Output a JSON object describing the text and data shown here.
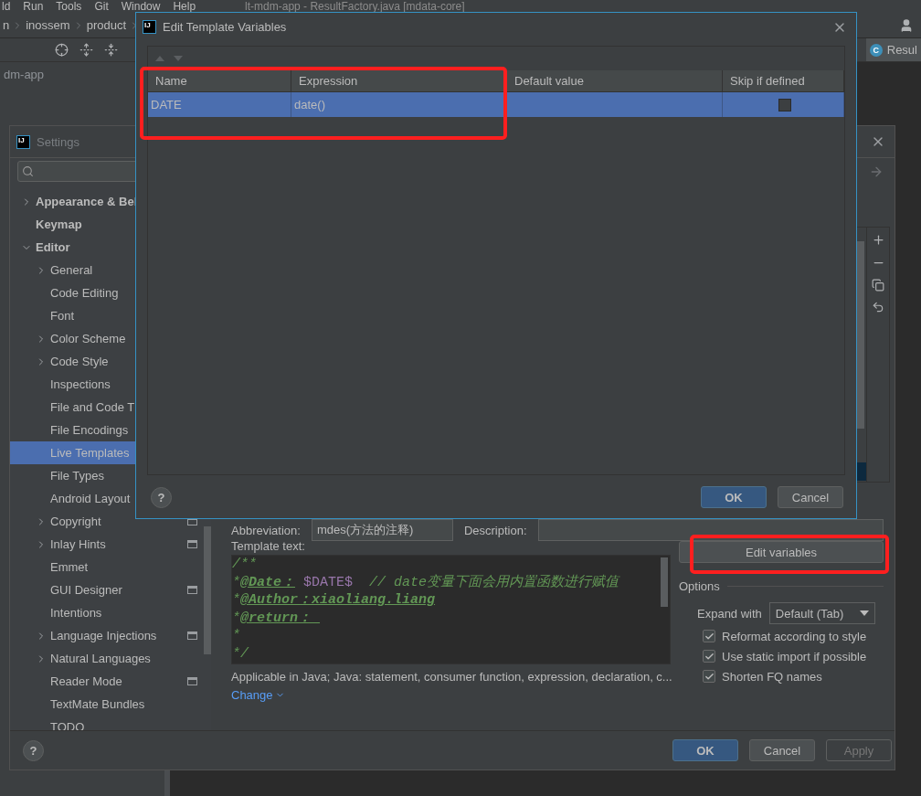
{
  "ide": {
    "menu": [
      "ld",
      "Run",
      "Tools",
      "Git",
      "Window",
      "Help"
    ],
    "title": "lt-mdm-app - ResultFactory.java [mdata-core]",
    "breadcrumbs": [
      "n",
      "inossem",
      "product"
    ],
    "project_root": "dm-app",
    "editor_tab_icon": "C",
    "editor_tab": "Resul"
  },
  "settings": {
    "logo": "IJ",
    "title": "Settings",
    "tree": [
      {
        "label": "Appearance & Bel",
        "expanded": false,
        "selected": false
      },
      {
        "label": "Keymap",
        "selected": false
      },
      {
        "label": "Editor",
        "expanded": true,
        "selected": false,
        "children": [
          {
            "label": "General",
            "expanded": false,
            "selected": false,
            "project_level": false
          },
          {
            "label": "Code Editing",
            "selected": false,
            "project_level": false
          },
          {
            "label": "Font",
            "selected": false,
            "project_level": false
          },
          {
            "label": "Color Scheme",
            "expanded": false,
            "selected": false,
            "project_level": false
          },
          {
            "label": "Code Style",
            "expanded": false,
            "selected": false,
            "project_level": false
          },
          {
            "label": "Inspections",
            "selected": false,
            "project_level": false
          },
          {
            "label": "File and Code T",
            "selected": false,
            "project_level": false
          },
          {
            "label": "File Encodings",
            "selected": false,
            "project_level": false
          },
          {
            "label": "Live Templates",
            "selected": true,
            "project_level": false
          },
          {
            "label": "File Types",
            "selected": false,
            "project_level": false
          },
          {
            "label": "Android Layout",
            "selected": false,
            "project_level": false
          },
          {
            "label": "Copyright",
            "expanded": false,
            "selected": false,
            "project_level": true
          },
          {
            "label": "Inlay Hints",
            "expanded": false,
            "selected": false,
            "project_level": true
          },
          {
            "label": "Emmet",
            "selected": false,
            "project_level": false
          },
          {
            "label": "GUI Designer",
            "selected": false,
            "project_level": true
          },
          {
            "label": "Intentions",
            "selected": false,
            "project_level": false
          },
          {
            "label": "Language Injections",
            "expanded": false,
            "selected": false,
            "project_level": true
          },
          {
            "label": "Natural Languages",
            "expanded": false,
            "selected": false,
            "project_level": false
          },
          {
            "label": "Reader Mode",
            "selected": false,
            "project_level": true
          },
          {
            "label": "TextMate Bundles",
            "selected": false,
            "project_level": false
          },
          {
            "label": "TODO",
            "selected": false,
            "project_level": false
          }
        ]
      }
    ],
    "abbreviation": {
      "label": "Abbreviation:",
      "value": "mdes(方法的注释)"
    },
    "description": {
      "label": "Description:"
    },
    "template_text": {
      "label": "Template text:",
      "lines": [
        [
          {
            "text": "/**",
            "kind": "comment"
          }
        ],
        [
          {
            "text": "*",
            "kind": "comment"
          },
          {
            "text": "@Date：",
            "kind": "tag"
          },
          {
            "text": " $DATE$",
            "kind": "variable"
          },
          {
            "text": "  // date变量下面会用内置函数进行赋值",
            "kind": "comment"
          }
        ],
        [
          {
            "text": "*",
            "kind": "comment"
          },
          {
            "text": "@Author：xiaoliang.liang",
            "kind": "tag"
          }
        ],
        [
          {
            "text": "*",
            "kind": "comment"
          },
          {
            "text": "@return： ",
            "kind": "tag"
          }
        ],
        [
          {
            "text": "*",
            "kind": "comment"
          }
        ],
        [
          {
            "text": "*/",
            "kind": "comment"
          }
        ]
      ]
    },
    "edit_variables": "Edit variables",
    "options": {
      "title": "Options",
      "expand_with": {
        "label": "Expand with",
        "value": "Default (Tab)"
      },
      "checkboxes": [
        {
          "label": "Reformat according to style",
          "checked": true
        },
        {
          "label": "Use static import if possible",
          "checked": true
        },
        {
          "label": "Shorten FQ names",
          "checked": true
        }
      ]
    },
    "applicable": "Applicable in Java; Java: statement, consumer function, expression, declaration, c...",
    "change": "Change",
    "help": "?",
    "buttons": [
      {
        "label": "OK",
        "kind": "primary"
      },
      {
        "label": "Cancel",
        "kind": "normal"
      },
      {
        "label": "Apply",
        "kind": "disabled"
      }
    ]
  },
  "dialog": {
    "logo": "IJ",
    "title": "Edit Template Variables",
    "columns": [
      "Name",
      "Expression",
      "Default value",
      "Skip if defined"
    ],
    "rows": [
      {
        "name": "DATE",
        "expression": "date()",
        "skip_if_defined": false,
        "selected": true
      }
    ],
    "help": "?",
    "buttons": [
      {
        "label": "OK",
        "kind": "primary"
      },
      {
        "label": "Cancel",
        "kind": "normal"
      }
    ]
  }
}
